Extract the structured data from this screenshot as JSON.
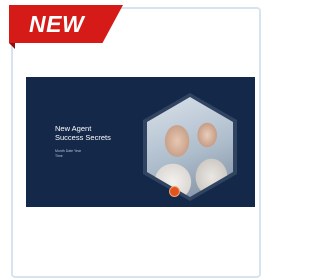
{
  "badge": {
    "label": "NEW"
  },
  "card": {
    "thumbnail": {
      "title_line1": "New Agent",
      "title_line2": "Success Secrets",
      "subtitle_line1": "Month Date Year",
      "subtitle_line2": "Time"
    }
  },
  "colors": {
    "badge_red": "#d51a17",
    "thumbnail_navy": "#14294a",
    "card_border": "#d7e4ef",
    "accent_orange": "#e0551d"
  }
}
